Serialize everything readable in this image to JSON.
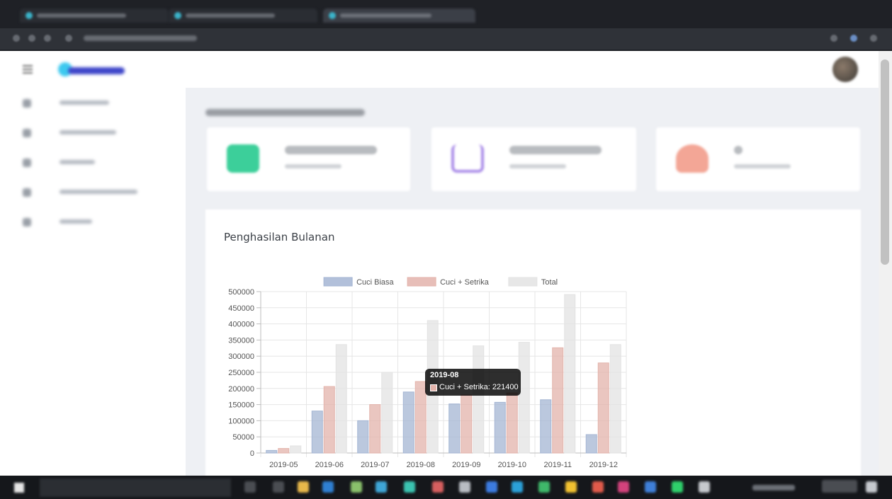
{
  "chart_card": {
    "title": "Penghasilan Bulanan"
  },
  "tooltip": {
    "title": "2019-08",
    "body": "Cuci + Setrika: 221400",
    "swatch_color": "#e3b3ab"
  },
  "colors": {
    "cuci_biasa": "#a4b5d3",
    "cuci_setrika": "#e3b3ab",
    "total": "#e3e3e3",
    "sidebar_bg": "#ffffff",
    "page_bg": "#eef0f4",
    "brand": "#3e46c9"
  },
  "icons": {
    "stat_income": "money-icon",
    "stat_laundry": "cart-icon",
    "stat_customers": "customers-icon"
  },
  "chart_data": {
    "type": "bar",
    "title": "",
    "xlabel": "",
    "ylabel": "",
    "ylim": [
      0,
      500000
    ],
    "yticks": [
      0,
      50000,
      100000,
      150000,
      200000,
      250000,
      300000,
      350000,
      400000,
      450000,
      500000
    ],
    "grid": true,
    "legend_position": "top",
    "categories": [
      "2019-05",
      "2019-06",
      "2019-07",
      "2019-08",
      "2019-09",
      "2019-10",
      "2019-11",
      "2019-12"
    ],
    "series": [
      {
        "name": "Cuci Biasa",
        "color": "#a4b5d3",
        "values": [
          8000,
          130000,
          100000,
          189000,
          152000,
          157000,
          165000,
          57000
        ]
      },
      {
        "name": "Cuci + Setrika",
        "color": "#e3b3ab",
        "values": [
          14000,
          206000,
          150000,
          221400,
          180000,
          186000,
          326000,
          279000
        ]
      },
      {
        "name": "Total",
        "color": "#e3e3e3",
        "values": [
          22000,
          336000,
          250000,
          410400,
          332000,
          343000,
          491000,
          336000
        ]
      }
    ]
  }
}
